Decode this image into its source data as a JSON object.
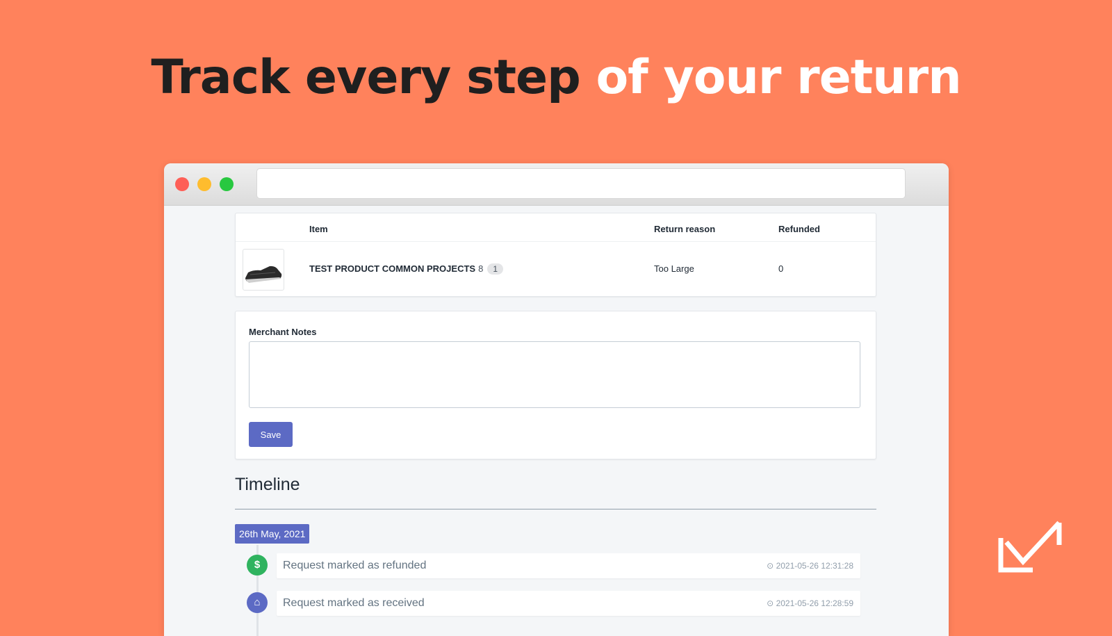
{
  "headline": {
    "dark": "Track every step",
    "light": "of your return"
  },
  "table": {
    "headers": {
      "item": "Item",
      "return_reason": "Return reason",
      "refunded": "Refunded"
    },
    "rows": [
      {
        "product": "TEST PRODUCT COMMON PROJECTS",
        "variant": "8",
        "quantity": "1",
        "return_reason": "Too Large",
        "refunded": "0",
        "thumbnail_icon": "sneaker-image"
      }
    ]
  },
  "notes": {
    "label": "Merchant Notes",
    "value": "",
    "save_label": "Save"
  },
  "timeline": {
    "title": "Timeline",
    "date": "26th May, 2021",
    "events": [
      {
        "icon": "$",
        "icon_name": "dollar-icon",
        "text": "Request marked as refunded",
        "time": "2021-05-26 12:31:28"
      },
      {
        "icon": "⌂",
        "icon_name": "inbox-icon",
        "text": "Request marked as received",
        "time": "2021-05-26 12:28:59"
      }
    ]
  },
  "colors": {
    "background": "#ff825c",
    "accent": "#5c6ac4",
    "success": "#2fb35f"
  }
}
